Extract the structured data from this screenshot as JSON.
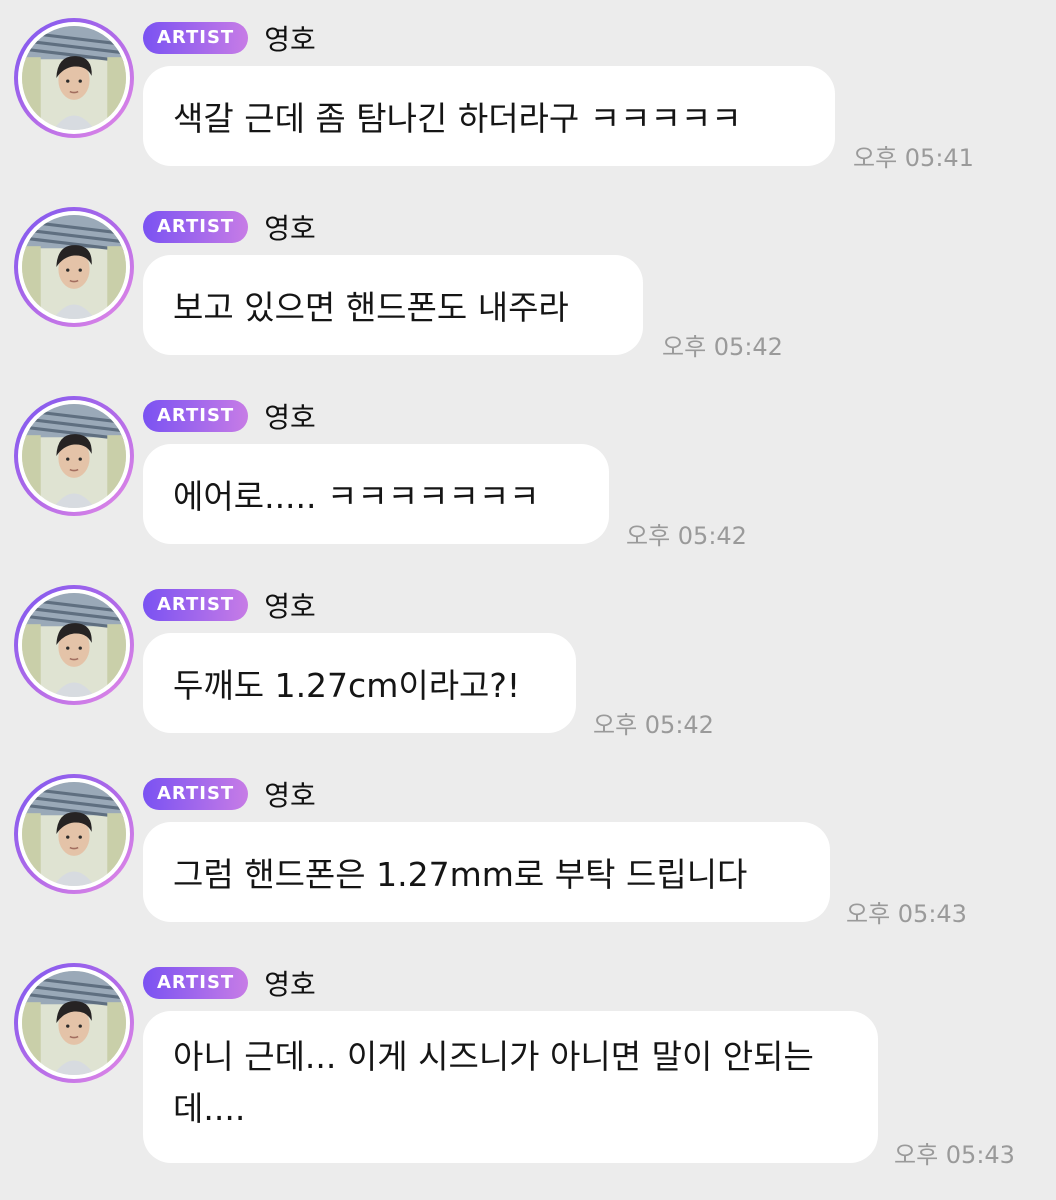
{
  "chat": {
    "messages": [
      {
        "badge": "ARTIST",
        "sender": "영호",
        "text": "색갈 근데 좀 탐나긴 하더라구 ㅋㅋㅋㅋㅋ",
        "time": "오후 05:41"
      },
      {
        "badge": "ARTIST",
        "sender": "영호",
        "text": "보고 있으면 핸드폰도 내주라",
        "time": "오후 05:42"
      },
      {
        "badge": "ARTIST",
        "sender": "영호",
        "text": "에어로..... ㅋㅋㅋㅋㅋㅋㅋ",
        "time": "오후 05:42"
      },
      {
        "badge": "ARTIST",
        "sender": "영호",
        "text": "두깨도 1.27cm이라고?!",
        "time": "오후 05:42"
      },
      {
        "badge": "ARTIST",
        "sender": "영호",
        "text": "그럼 핸드폰은 1.27mm로 부탁 드립니다",
        "time": "오후 05:43"
      },
      {
        "badge": "ARTIST",
        "sender": "영호",
        "text": "아니 근데... 이게 시즈니가 아니면 말이 안되는데....",
        "time": "오후 05:43"
      }
    ]
  },
  "colors": {
    "background": "#ececec",
    "bubble": "#ffffff",
    "badge_start": "#7a52f2",
    "badge_end": "#c77ce6",
    "timestamp": "#9a9a9a"
  },
  "icons": {
    "avatar": "artist-profile-photo"
  }
}
